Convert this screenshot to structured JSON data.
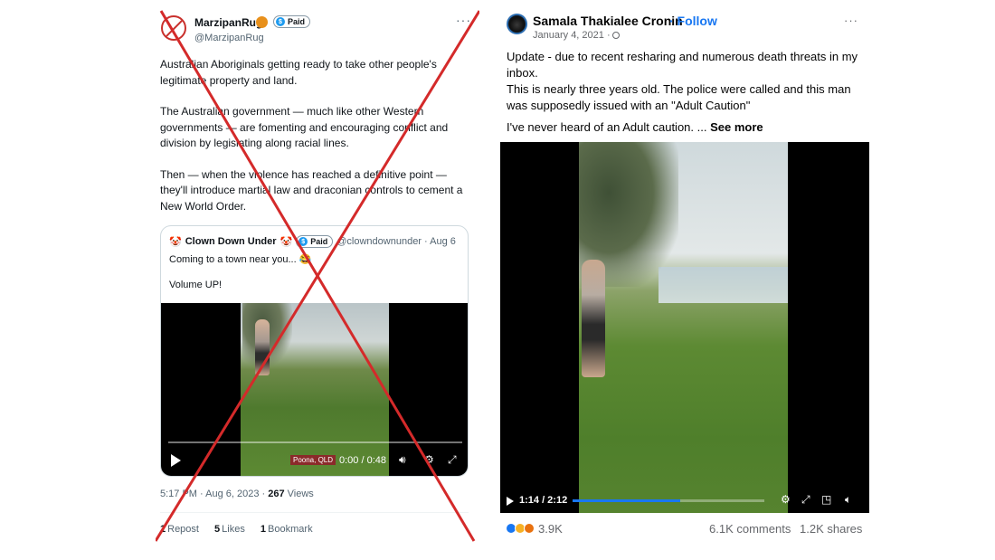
{
  "tweet": {
    "author": "MarzipanRug",
    "paid_label": "Paid",
    "handle": "@MarzipanRug",
    "more": "···",
    "paragraphs": [
      "Australian Aboriginals getting ready to take other people's legitimate property and land.",
      "The Australian government — much like other Western governments — are fomenting and encouraging conflict and division by legislating along racial lines.",
      "Then — when the violence has reached a definitive point — they'll introduce martial law and draconian controls to cement a New World Order."
    ],
    "quote": {
      "author": "Clown Down Under",
      "paid_label": "Paid",
      "handle": "@clowndownunder · Aug 6",
      "text_line1": "Coming to a town near you... 😂",
      "text_line2": "Volume UP!",
      "video": {
        "location": "Poona, QLD",
        "time": "0:00 / 0:48"
      }
    },
    "meta": {
      "timestamp": "5:17 PM · Aug 6, 2023 · ",
      "views_count": "267",
      "views_label": " Views"
    },
    "stats": {
      "reposts_count": "1",
      "reposts_label": "Repost",
      "likes_count": "5",
      "likes_label": "Likes",
      "bookmarks_count": "1",
      "bookmarks_label": "Bookmark"
    },
    "cross_color": "#d42a2a"
  },
  "facebook": {
    "author": "Samala Thakialee Cronin",
    "follow": " · Follow",
    "date": "January 4, 2021 ·",
    "more": "···",
    "line1": "Update - due to recent resharing and numerous death threats in my inbox.",
    "line2": "This is nearly three years old. The police were called and this man was supposedly issued with an \"Adult Caution\"",
    "line3": "I've never heard of an Adult caution. ...",
    "see_more": " See more",
    "video": {
      "time": "1:14 / 2:12",
      "progress": 0.56
    },
    "reactions_count": "3.9K",
    "comments": "6.1K comments",
    "shares": "1.2K shares",
    "link_color": "#1877f2"
  }
}
